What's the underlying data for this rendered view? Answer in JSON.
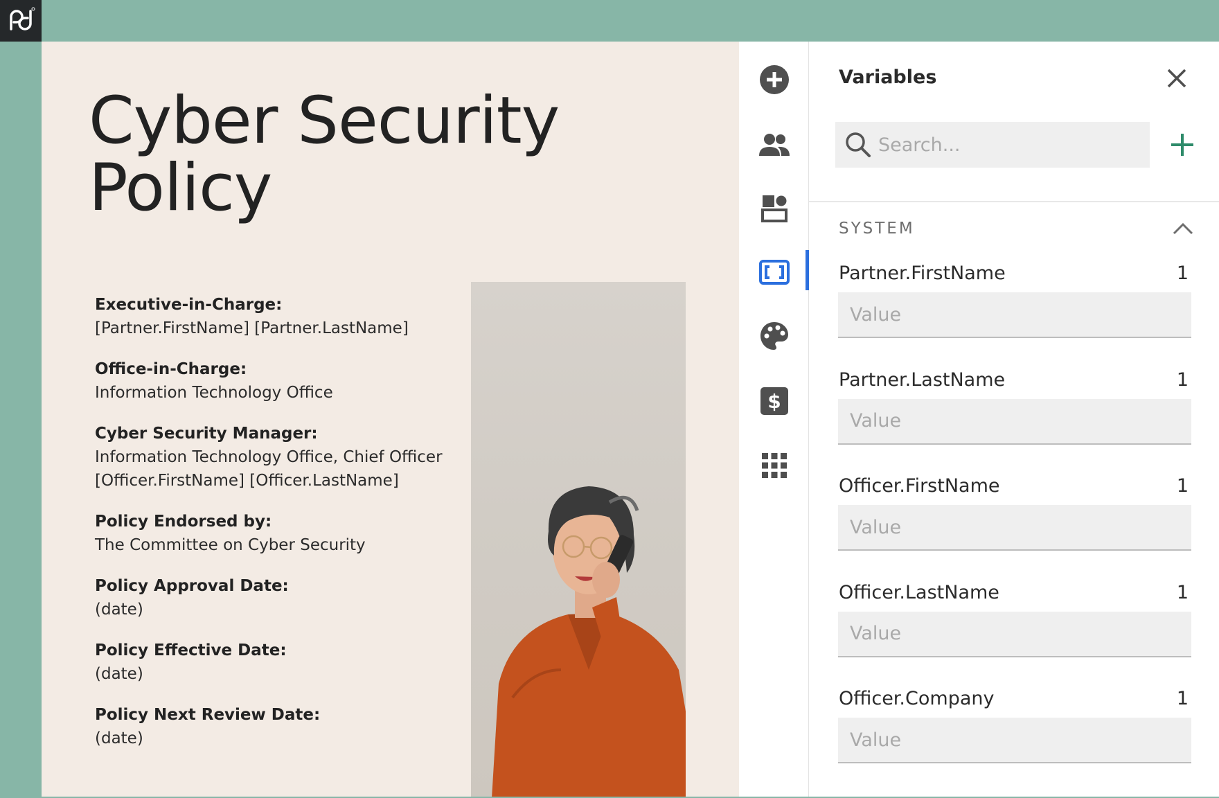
{
  "colors": {
    "accent_blue": "#2b6fde",
    "accent_green": "#2e8b6a",
    "frame_teal": "#87b6a7",
    "document_bg": "#f3ebe4"
  },
  "document": {
    "title": "Cyber Security Policy",
    "fields": [
      {
        "label": "Executive-in-Charge:",
        "value": "[Partner.FirstName] [Partner.LastName]"
      },
      {
        "label": "Office-in-Charge:",
        "value": "Information Technology Office"
      },
      {
        "label": "Cyber Security Manager:",
        "value": "Information Technology Office, Chief Officer\n[Officer.FirstName] [Officer.LastName]"
      },
      {
        "label": "Policy Endorsed by:",
        "value": "The Committee on Cyber Security"
      },
      {
        "label": "Policy Approval Date:",
        "value": "(date)"
      },
      {
        "label": "Policy Effective Date:",
        "value": "(date)"
      },
      {
        "label": "Policy Next Review Date:",
        "value": "(date)"
      }
    ]
  },
  "rail": {
    "items": [
      {
        "icon": "add-circle-icon"
      },
      {
        "icon": "recipients-icon"
      },
      {
        "icon": "content-blocks-icon"
      },
      {
        "icon": "variables-icon",
        "active": true
      },
      {
        "icon": "design-palette-icon"
      },
      {
        "icon": "pricing-dollar-icon"
      },
      {
        "icon": "apps-grid-icon"
      }
    ]
  },
  "panel": {
    "title": "Variables",
    "search_placeholder": "Search...",
    "section_label": "SYSTEM",
    "value_placeholder": "Value",
    "variables": [
      {
        "name": "Partner.FirstName",
        "count": "1"
      },
      {
        "name": "Partner.LastName",
        "count": "1"
      },
      {
        "name": "Officer.FirstName",
        "count": "1"
      },
      {
        "name": "Officer.LastName",
        "count": "1"
      },
      {
        "name": "Officer.Company",
        "count": "1"
      }
    ]
  }
}
